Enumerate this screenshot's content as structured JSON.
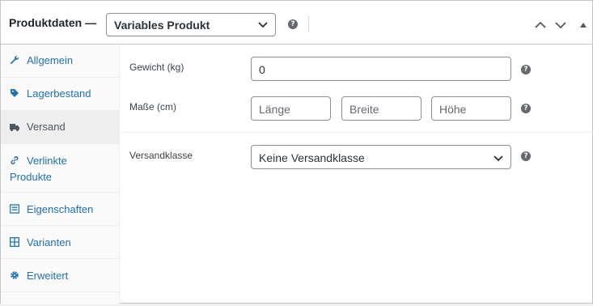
{
  "header": {
    "title": "Produktdaten —",
    "product_type": "Variables Produkt",
    "help": "?"
  },
  "tabs": [
    {
      "label": "Allgemein",
      "icon": "wrench-icon"
    },
    {
      "label": "Lagerbestand",
      "icon": "tag-icon"
    },
    {
      "label": "Versand",
      "icon": "truck-icon"
    },
    {
      "label": "Verlinkte Produkte",
      "icon": "link-icon"
    },
    {
      "label": "Eigenschaften",
      "icon": "list-icon"
    },
    {
      "label": "Varianten",
      "icon": "grid-icon"
    },
    {
      "label": "Erweitert",
      "icon": "gear-icon"
    }
  ],
  "shipping": {
    "weight_label": "Gewicht (kg)",
    "weight_value": "0",
    "dimensions_label": "Maße (cm)",
    "length_placeholder": "Länge",
    "width_placeholder": "Breite",
    "height_placeholder": "Höhe",
    "class_label": "Versandklasse",
    "class_value": "Keine Versandklasse"
  },
  "colors": {
    "link": "#2271b1",
    "active_tab_bg": "#eeeeee",
    "border": "#c3c4c7"
  }
}
